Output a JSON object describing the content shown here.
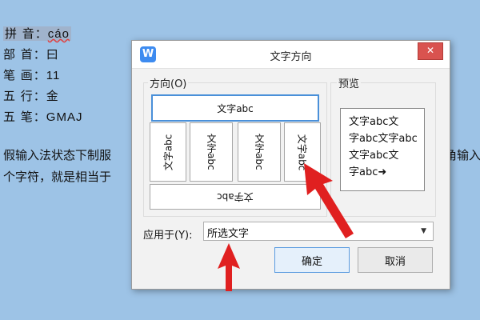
{
  "document": {
    "lines": [
      {
        "label": "拼 音：",
        "value": "cáo"
      },
      {
        "label": "部 首：",
        "value": "曰"
      },
      {
        "label": "笔 画：",
        "value": "11"
      },
      {
        "label": "五 行：",
        "value": "金"
      },
      {
        "label": "五 笔：",
        "value": "GMAJ"
      }
    ],
    "body_line1_left": "假输入法状态下制服",
    "body_line1_right": "角输入",
    "body_line2_left": "个字符，就是相当于"
  },
  "dialog": {
    "title": "文字方向",
    "close_label": "✕",
    "direction_group_label": "方向(O)",
    "preview_group_label": "预览",
    "options": {
      "horizontal": "文字abc",
      "vertical_a": "文字abc",
      "vertical_b": "文字abc",
      "vertical_c": "文字abc",
      "vertical_d": "文字abc",
      "vertical_e": "文字abc",
      "bottom": "文字abc"
    },
    "preview_lines": [
      "文字abc文",
      "字abc文字abc",
      "文字abc文",
      "字abc➜"
    ],
    "apply_label": "应用于(Y):",
    "apply_value": "所选文字",
    "ok_label": "确定",
    "cancel_label": "取消"
  }
}
